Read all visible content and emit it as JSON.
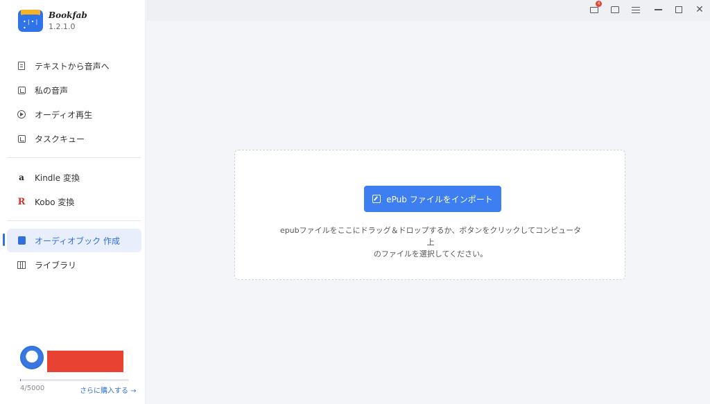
{
  "app": {
    "name": "Bookfab",
    "version": "1.2.1.0"
  },
  "sidebar": {
    "items": [
      {
        "label": "テキストから音声へ",
        "icon": "document-icon"
      },
      {
        "label": "私の音声",
        "icon": "voice-library-icon"
      },
      {
        "label": "オーディオ再生",
        "icon": "play-circle-icon"
      },
      {
        "label": "タスクキュー",
        "icon": "task-queue-icon"
      },
      {
        "label": "Kindle 変換",
        "icon": "amazon-icon"
      },
      {
        "label": "Kobo 変換",
        "icon": "kobo-icon"
      },
      {
        "label": "オーディオブック 作成",
        "icon": "book-icon",
        "active": true
      },
      {
        "label": "ライブラリ",
        "icon": "library-icon"
      }
    ],
    "user": {
      "usage": "4/5000",
      "usage_fraction": 0.0008,
      "buy_more_label": "さらに購入する →"
    }
  },
  "titlebar": {
    "notification_count": "4"
  },
  "main": {
    "import_button_label": "ePub ファイルをインポート",
    "hint_line1": "epubファイルをここにドラッグ＆ドロップするか、ボタンをクリックしてコンピュータ上",
    "hint_line2": "のファイルを選択してください。"
  },
  "colors": {
    "accent": "#2f6fe0",
    "button": "#3d7ff0",
    "badge": "#e84332"
  }
}
